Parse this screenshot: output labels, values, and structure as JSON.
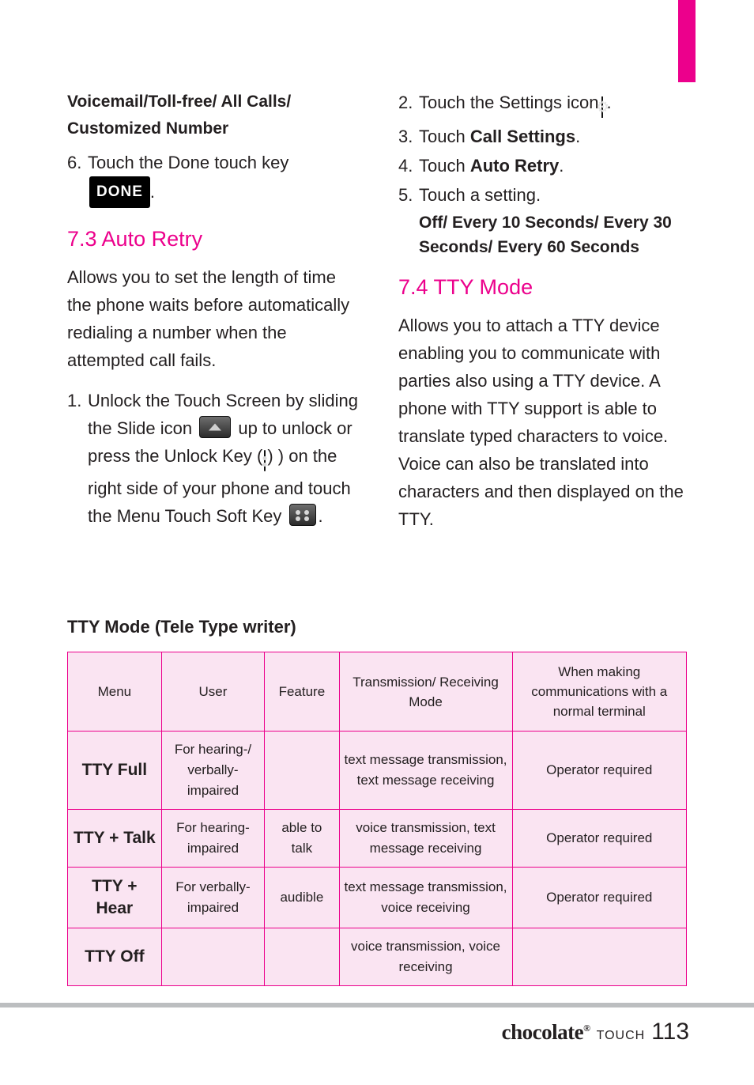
{
  "left_column": {
    "heading": "Voicemail/Toll-free/ All Calls/ Customized Number",
    "step6_num": "6.",
    "step6_text": "Touch the Done touch key",
    "done_key_label": "DONE",
    "done_key_trailing": ".",
    "section_73_title": "7.3 Auto Retry",
    "section_73_body": "Allows you to set the length of time the phone waits before automatically redialing a number when the attempted call fails.",
    "step1_num": "1.",
    "step1_part1": "Unlock the Touch Screen by sliding the Slide icon",
    "step1_part2": "up to unlock or press the Unlock Key",
    "step1_part3": "(",
    "step1_part4": ") on the right side of your phone and touch the Menu Touch Soft Key",
    "step1_part5": "."
  },
  "right_column": {
    "step2_num": "2.",
    "step2_text": "Touch the Settings icon",
    "step2_trailing": ".",
    "step3_num": "3.",
    "step3_text_pre": "Touch ",
    "step3_text_bold": "Call Settings",
    "step3_text_post": ".",
    "step4_num": "4.",
    "step4_text_pre": "Touch ",
    "step4_text_bold": "Auto Retry",
    "step4_text_post": ".",
    "step5_num": "5.",
    "step5_text": "Touch a setting.",
    "step5_options": "Off/ Every 10 Seconds/ Every 30 Seconds/ Every 60 Seconds",
    "section_74_title": "7.4 TTY Mode",
    "section_74_body": "Allows you to attach a TTY device enabling you to communicate with parties also using a TTY device. A phone with TTY support is able to translate typed characters to voice. Voice can also be translated into characters and then displayed on the TTY."
  },
  "table": {
    "caption": "TTY Mode (Tele Type writer)",
    "headers": [
      "Menu",
      "User",
      "Feature",
      "Transmission/ Receiving Mode",
      "When making communications with a normal terminal"
    ],
    "rows": [
      {
        "menu": "TTY Full",
        "user": "For hearing-/ verbally- impaired",
        "feature": "",
        "mode": "text message transmission, text message receiving",
        "normal": "Operator required"
      },
      {
        "menu": "TTY + Talk",
        "user": "For hearing- impaired",
        "feature": "able to talk",
        "mode": "voice transmission, text message receiving",
        "normal": "Operator required"
      },
      {
        "menu": "TTY + Hear",
        "user": "For verbally- impaired",
        "feature": "audible",
        "mode": "text message transmission, voice receiving",
        "normal": "Operator required"
      },
      {
        "menu": "TTY Off",
        "user": "",
        "feature": "",
        "mode": "voice transmission, voice receiving",
        "normal": ""
      }
    ]
  },
  "footer": {
    "brand": "chocolate",
    "brand_mark": "®",
    "brand_sub": "TOUCH",
    "page_number": "113"
  },
  "colors": {
    "accent": "#ec008c",
    "table_fill": "#fae4f2",
    "text": "#231f20",
    "rule": "#bcbec0"
  }
}
